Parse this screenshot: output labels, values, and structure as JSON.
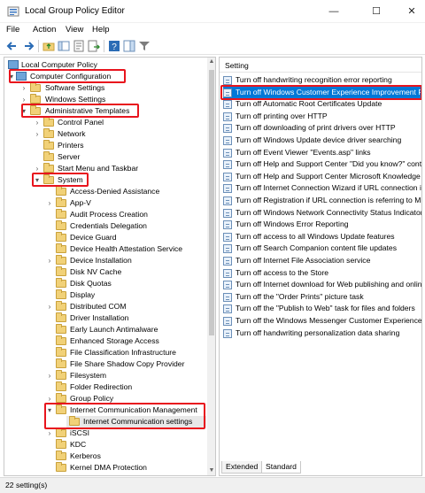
{
  "window": {
    "title": "Local Group Policy Editor",
    "controls": [
      "—",
      "☐",
      "✕"
    ]
  },
  "menu": [
    "File",
    "Action",
    "View",
    "Help"
  ],
  "tree": [
    {
      "label": "Local Computer Policy",
      "icon": "computer-icon"
    },
    {
      "label": "Computer Configuration",
      "icon": "computer-icon"
    },
    {
      "label": "Software Settings"
    },
    {
      "label": "Windows Settings"
    },
    {
      "label": "Administrative Templates"
    },
    {
      "label": "Control Panel"
    },
    {
      "label": "Network"
    },
    {
      "label": "Printers"
    },
    {
      "label": "Server"
    },
    {
      "label": "Start Menu and Taskbar"
    },
    {
      "label": "System"
    },
    {
      "label": "Access-Denied Assistance"
    },
    {
      "label": "App-V"
    },
    {
      "label": "Audit Process Creation"
    },
    {
      "label": "Credentials Delegation"
    },
    {
      "label": "Device Guard"
    },
    {
      "label": "Device Health Attestation Service"
    },
    {
      "label": "Device Installation"
    },
    {
      "label": "Disk NV Cache"
    },
    {
      "label": "Disk Quotas"
    },
    {
      "label": "Display"
    },
    {
      "label": "Distributed COM"
    },
    {
      "label": "Driver Installation"
    },
    {
      "label": "Early Launch Antimalware"
    },
    {
      "label": "Enhanced Storage Access"
    },
    {
      "label": "File Classification Infrastructure"
    },
    {
      "label": "File Share Shadow Copy Provider"
    },
    {
      "label": "Filesystem"
    },
    {
      "label": "Folder Redirection"
    },
    {
      "label": "Group Policy"
    },
    {
      "label": "Internet Communication Management"
    },
    {
      "label": "Internet Communication settings"
    },
    {
      "label": "iSCSI"
    },
    {
      "label": "KDC"
    },
    {
      "label": "Kerberos"
    },
    {
      "label": "Kernel DMA Protection"
    }
  ],
  "settings": {
    "column_header": "Setting",
    "items": [
      "Turn off handwriting recognition error reporting",
      "Turn off Windows Customer Experience Improvement Program",
      "Turn off Automatic Root Certificates Update",
      "Turn off printing over HTTP",
      "Turn off downloading of print drivers over HTTP",
      "Turn off Windows Update device driver searching",
      "Turn off Event Viewer \"Events.asp\" links",
      "Turn off Help and Support Center \"Did you know?\" content",
      "Turn off Help and Support Center Microsoft Knowledge Base search",
      "Turn off Internet Connection Wizard if URL connection is referring to Microsoft.com",
      "Turn off Registration if URL connection is referring to Microsoft.com",
      "Turn off Windows Network Connectivity Status Indicator active tests",
      "Turn off Windows Error Reporting",
      "Turn off access to all Windows Update features",
      "Turn off Search Companion content file updates",
      "Turn off Internet File Association service",
      "Turn off access to the Store",
      "Turn off Internet download for Web publishing and online ordering wizards",
      "Turn off the \"Order Prints\" picture task",
      "Turn off the \"Publish to Web\" task for files and folders",
      "Turn off the Windows Messenger Customer Experience Improvement Program",
      "Turn off handwriting personalization data sharing"
    ]
  },
  "tabs": [
    "Extended",
    "Standard"
  ],
  "status": "22 setting(s)",
  "colors": {
    "highlight": "#e8141d",
    "selection": "#0078d7",
    "folder": "#f1d178"
  }
}
